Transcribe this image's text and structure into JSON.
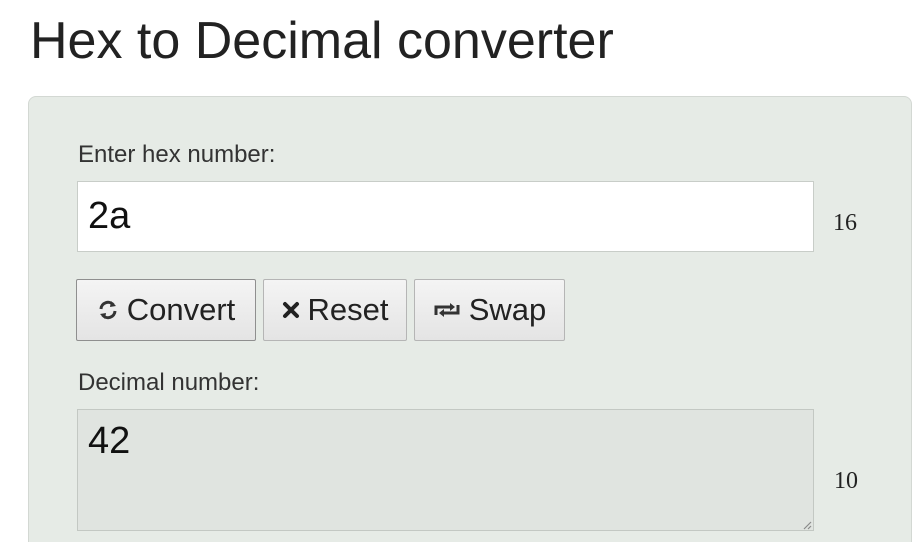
{
  "page": {
    "title": "Hex to Decimal converter"
  },
  "converter": {
    "hex_label": "Enter hex number:",
    "hex_value": "2a",
    "hex_base": "16",
    "decimal_label": "Decimal number:",
    "decimal_value": "42",
    "decimal_base": "10"
  },
  "buttons": {
    "convert_label": "Convert",
    "reset_label": "Reset",
    "swap_label": "Swap"
  },
  "icons": {
    "convert": "refresh-icon",
    "reset": "close-icon",
    "swap": "swap-icon",
    "textarea": "resize-grip-icon"
  },
  "colors": {
    "panel_background": "#e6ebe6",
    "button_background": "#f0f0f0",
    "output_background": "#e0e4e0"
  }
}
